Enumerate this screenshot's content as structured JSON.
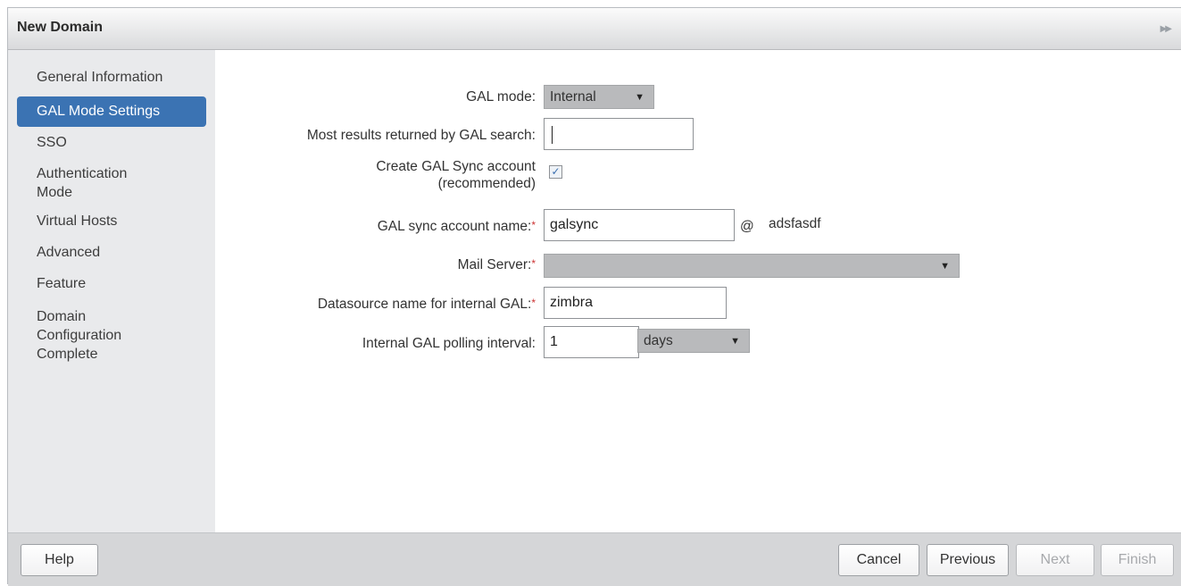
{
  "window": {
    "title": "New Domain"
  },
  "sidebar": {
    "items": [
      {
        "label": "General Information"
      },
      {
        "label": "GAL Mode Settings"
      },
      {
        "label": "SSO"
      },
      {
        "label": "Authentication\nMode"
      },
      {
        "label": "Virtual Hosts"
      },
      {
        "label": "Advanced"
      },
      {
        "label": "Feature"
      },
      {
        "label": "Domain\nConfiguration\nComplete"
      }
    ],
    "active": "GAL Mode Settings"
  },
  "form": {
    "gal_mode": {
      "label": "GAL mode:",
      "value": "Internal"
    },
    "max_results": {
      "label": "Most results returned by GAL search:",
      "value": ""
    },
    "create_sync": {
      "label": "Create GAL Sync account\n(recommended)",
      "checked": true
    },
    "sync_account": {
      "label": "GAL sync account name:",
      "value": "galsync",
      "at": "@",
      "domain": "adsfasdf"
    },
    "mail_server": {
      "label": "Mail Server:",
      "value": ""
    },
    "datasource": {
      "label": "Datasource name for internal GAL:",
      "value": "zimbra"
    },
    "polling": {
      "label": "Internal GAL polling interval:",
      "value": "1",
      "unit": "days"
    },
    "required_mark": "*"
  },
  "footer": {
    "help": "Help",
    "cancel": "Cancel",
    "previous": "Previous",
    "next": "Next",
    "finish": "Finish"
  },
  "icons": {
    "expand": "double-chevron-right-icon",
    "dropdown": "caret-down-icon",
    "check": "checkmark-icon"
  }
}
